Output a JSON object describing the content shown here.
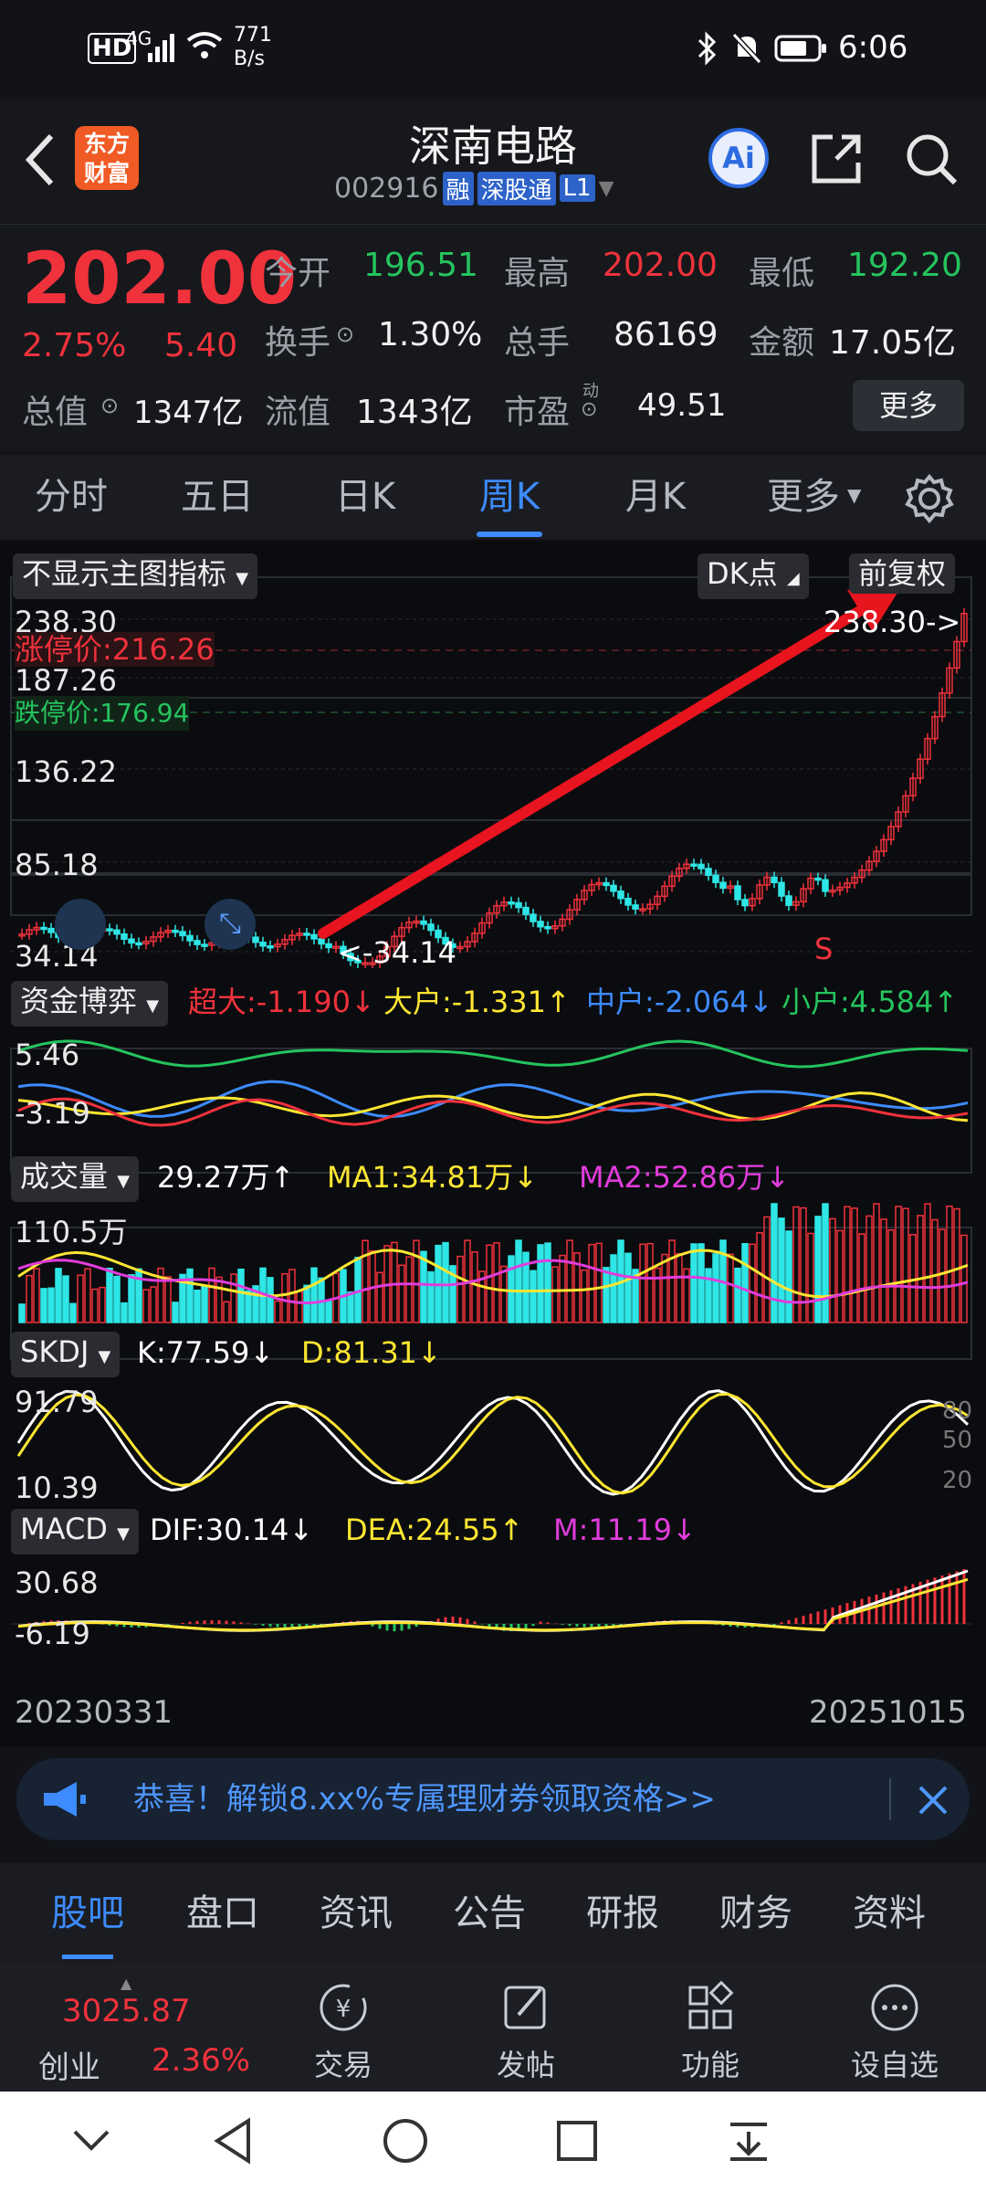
{
  "status": {
    "net_speed": "771",
    "net_unit": "B/s",
    "time": "6:06",
    "net": "4G",
    "hd": "HD"
  },
  "header": {
    "logo_line1": "东方",
    "logo_line2": "财富",
    "title": "深南电路",
    "code": "002916",
    "badge_rong": "融",
    "badge_sgt": "深股通",
    "badge_l1": "L1",
    "ai_label": "Ai"
  },
  "quote": {
    "price": "202.00",
    "pct": "2.75%",
    "change": "5.40",
    "open_label": "今开",
    "open": "196.51",
    "high_label": "最高",
    "high": "202.00",
    "low_label": "最低",
    "low": "192.20",
    "turnover_label": "换手",
    "turnover": "1.30%",
    "vol_label": "总手",
    "vol": "86169",
    "amount_label": "金额",
    "amount": "17.05亿",
    "mcap_label": "总值",
    "mcap": "1347亿",
    "float_label": "流值",
    "float": "1343亿",
    "pe_label": "市盈",
    "pe_sup": "动",
    "pe": "49.51",
    "more": "更多"
  },
  "tabs": [
    "分时",
    "五日",
    "日K",
    "周K",
    "月K",
    "更多"
  ],
  "tab_active": "周K",
  "chart": {
    "indicator_select": "不显示主图指标",
    "dk_label": "DK点",
    "adjust_label": "前复权",
    "y_labels": [
      "238.30",
      "187.26",
      "136.22",
      "85.18",
      "34.14"
    ],
    "limit_up": "涨停价:216.26",
    "limit_down": "跌停价:176.94",
    "max_marker": "238.30->",
    "min_marker": "<-34.14",
    "s_marker": "S",
    "fund_select": "资金博弈",
    "fund_super": "超大:-1.190↓",
    "fund_big": "大户:-1.331↑",
    "fund_mid": "中户:-2.064↓",
    "fund_small": "小户:4.584↑",
    "fund_y": [
      "5.46",
      "-3.19"
    ],
    "vol_select": "成交量",
    "vol_val": "29.27万↑",
    "vol_ma1": "MA1:34.81万↓",
    "vol_ma2": "MA2:52.86万↓",
    "vol_y": "110.5万",
    "skdj_select": "SKDJ",
    "skdj_k": "K:77.59↓",
    "skdj_d": "D:81.31↓",
    "skdj_y": [
      "91.79",
      "10.39"
    ],
    "skdj_lv": [
      "80",
      "50",
      "20"
    ],
    "macd_select": "MACD",
    "macd_dif": "DIF:30.14↓",
    "macd_dea": "DEA:24.55↑",
    "macd_m": "M:11.19↓",
    "macd_y": [
      "30.68",
      "-6.19"
    ],
    "date_start": "20230331",
    "date_end": "20251015"
  },
  "banner": {
    "text": "恭喜！解锁8.xx%专属理财券领取资格>>"
  },
  "bottom_tabs": [
    "股吧",
    "盘口",
    "资讯",
    "公告",
    "研报",
    "财务",
    "资料"
  ],
  "toolbar": {
    "index_value": "3025.87",
    "index_name": "创业",
    "index_pct": "2.36%",
    "trade": "交易",
    "post": "发帖",
    "func": "功能",
    "watch": "设自选"
  },
  "colors": {
    "up": "#f0323c",
    "down": "#25c45e",
    "accent": "#3d8bff",
    "yellow": "#ffe632",
    "magenta": "#e13cdc",
    "cyan": "#2ee6e6"
  }
}
